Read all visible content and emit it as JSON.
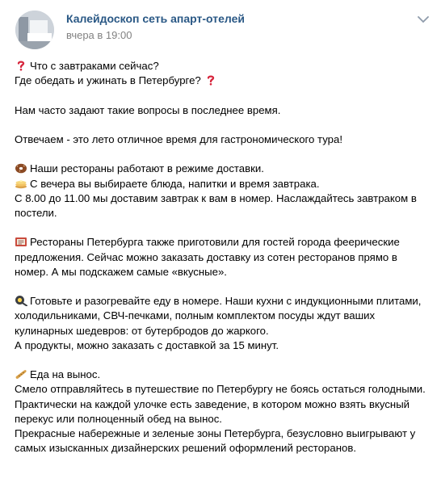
{
  "post": {
    "author": "Калейдоскоп сеть апарт-отелей",
    "time": "вчера в 19:00",
    "lines": [
      {
        "icon": "question-mark-icon",
        "text": "Что с завтраками сейчас?"
      },
      {
        "text": "Где обедать и ужинать в Петербурге?",
        "icon_after": "question-mark-icon"
      },
      {
        "blank": true
      },
      {
        "text": "Нам часто задают такие вопросы в последнее время."
      },
      {
        "blank": true
      },
      {
        "text": "Отвечаем - это лето отличное время для гастрономического тура!"
      },
      {
        "blank": true
      },
      {
        "icon": "donut-icon",
        "text": "Наши рестораны работают в режиме доставки."
      },
      {
        "icon": "pancakes-icon",
        "text": "С вечера вы выбираете блюда, напитки и время завтрака."
      },
      {
        "text": "С 8.00 до 11.00 мы доставим завтрак к вам в номер. Наслаждайтесь завтраком в"
      },
      {
        "text": "постели."
      },
      {
        "blank": true
      },
      {
        "icon": "menu-sign-icon",
        "text": "Рестораны Петербурга также приготовили для гостей города феерические"
      },
      {
        "text": "предложения. Сейчас можно заказать доставку из сотен ресторанов прямо в"
      },
      {
        "text": "номер. А мы подскажем самые «вкусные»."
      },
      {
        "blank": true
      },
      {
        "icon": "frying-pan-icon",
        "text": "Готовьте и разогревайте еду в номере. Наши кухни с индукционными плитами,"
      },
      {
        "text": "холодильниками, СВЧ-печками, полным комплектом посуды ждут ваших"
      },
      {
        "text": "кулинарных шедевров: от бутербродов до жаркого."
      },
      {
        "text": "А продукты, можно заказать с доставкой за 15 минут."
      },
      {
        "blank": true
      },
      {
        "icon": "baguette-icon",
        "text": "Еда на вынос."
      },
      {
        "text": "Смело отправляйтесь в путешествие по Петербургу не боясь остаться голодными."
      },
      {
        "text": "Практически на каждой улочке есть заведение, в котором можно взять вкусный"
      },
      {
        "text": "перекус или полноценный обед на вынос."
      },
      {
        "text": "Прекрасные набережные и зеленые зоны Петербурга, безусловно выигрывают у"
      },
      {
        "text": "самых изысканных дизайнерских решений оформлений ресторанов."
      }
    ]
  }
}
